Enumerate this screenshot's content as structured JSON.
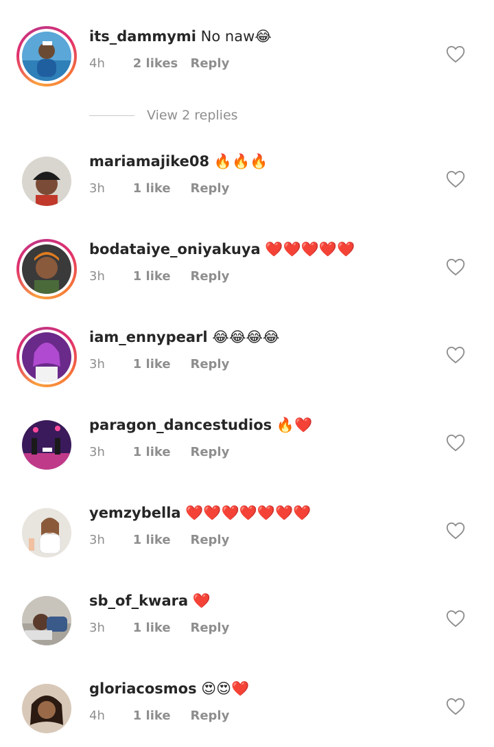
{
  "view_replies": {
    "label": "View 2 replies"
  },
  "comments": [
    {
      "username": "its_dammymi",
      "text": "No naw😂",
      "time": "4h",
      "likes": "2 likes",
      "reply": "Reply",
      "avatar": "avatar-person-blue",
      "story_ring": true
    },
    {
      "username": "mariamajike08",
      "text": "🔥🔥🔥",
      "time": "3h",
      "likes": "1 like",
      "reply": "Reply",
      "avatar": "avatar-person-cap",
      "story_ring": false
    },
    {
      "username": "bodataiye_oniyakuya",
      "text": "❤️❤️❤️❤️❤️",
      "time": "3h",
      "likes": "1 like",
      "reply": "Reply",
      "avatar": "avatar-person-man",
      "story_ring": true
    },
    {
      "username": "iam_ennypearl",
      "text": "😂😂😂😂",
      "time": "3h",
      "likes": "1 like",
      "reply": "Reply",
      "avatar": "avatar-person-purple",
      "story_ring": true
    },
    {
      "username": "paragon_dancestudios",
      "text": "🔥❤️",
      "time": "3h",
      "likes": "1 like",
      "reply": "Reply",
      "avatar": "avatar-dance-stage",
      "story_ring": false
    },
    {
      "username": "yemzybella",
      "text": "❤️❤️❤️❤️❤️❤️❤️",
      "time": "3h",
      "likes": "1 like",
      "reply": "Reply",
      "avatar": "avatar-person-white",
      "story_ring": false
    },
    {
      "username": "sb_of_kwara",
      "text": "❤️",
      "time": "3h",
      "likes": "1 like",
      "reply": "Reply",
      "avatar": "avatar-person-lying",
      "story_ring": false
    },
    {
      "username": "gloriacosmos",
      "text": "😍😍❤️",
      "time": "4h",
      "likes": "1 like",
      "reply": "Reply",
      "avatar": "avatar-person-selfie",
      "story_ring": false
    }
  ],
  "icons": {
    "like": "heart-outline-icon"
  },
  "colors": {
    "username": "#262626",
    "meta": "#8e8e8e",
    "story_ring": "#e1306c"
  }
}
